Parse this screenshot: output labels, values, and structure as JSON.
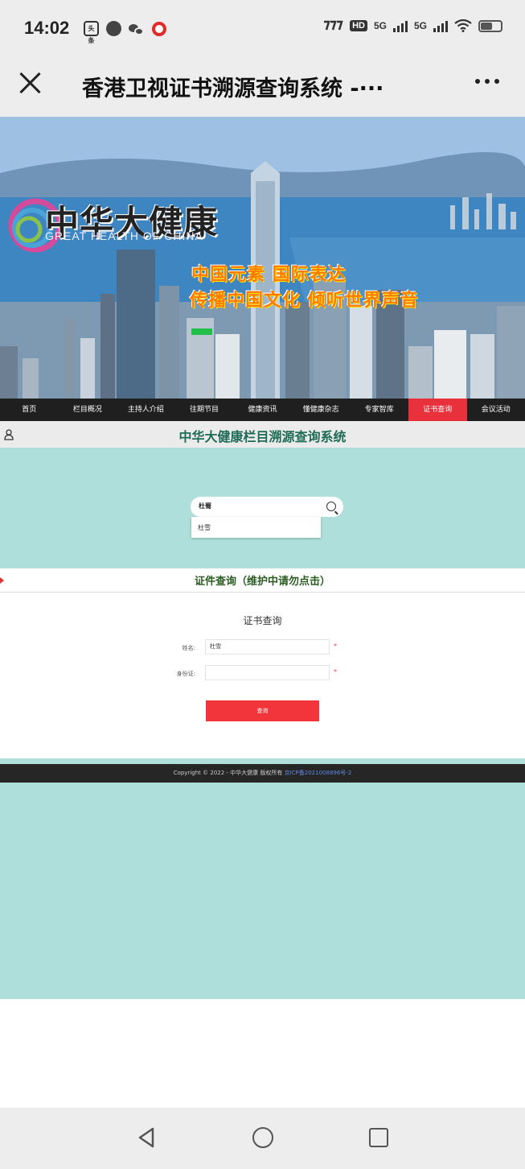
{
  "status_bar": {
    "time": "14:02",
    "left_icons": [
      "toutiao-icon",
      "compass-icon",
      "wechat-icon",
      "red-record-icon"
    ],
    "toutiao_label": "头条",
    "hd_label": "HD",
    "hd_sub": "1 2",
    "signal_1": "5G",
    "signal_2": "5G"
  },
  "title_bar": {
    "title": "香港卫视证书溯源查询系统 -···"
  },
  "banner": {
    "brand_name": "中华大健康",
    "brand_sub": "GREAT HEALTH OF CHINA",
    "slogan_1": "中国元素 国际表达",
    "slogan_2": "传播中国文化 倾听世界声音"
  },
  "nav": {
    "items": [
      "首页",
      "栏目概况",
      "主持人介绍",
      "往期节目",
      "健康资讯",
      "懂健康杂志",
      "专家智库",
      "证书查询",
      "会议活动"
    ],
    "active_index": 7,
    "active_color": "#e8313b"
  },
  "system": {
    "title": "中华大健康栏目溯源查询系统"
  },
  "search": {
    "value": "杜蜀",
    "suggestion": "杜雪"
  },
  "certificate": {
    "header": "证件查询（维护中请勿点击）",
    "form_title": "证书查询",
    "name_label": "姓名:",
    "name_value": "杜雪",
    "id_label": "身份证:",
    "id_value": "",
    "required_mark": "*",
    "submit_label": "查询",
    "submit_color": "#f2353a"
  },
  "footer": {
    "copyright": "Copyright © 2022 - 中华大健康 版权所有",
    "icp": "京ICP备2021008896号-2"
  },
  "colors": {
    "teal_bg": "#aedfdb",
    "dark_nav": "#1f1f1f",
    "system_title": "#1d6b55"
  }
}
